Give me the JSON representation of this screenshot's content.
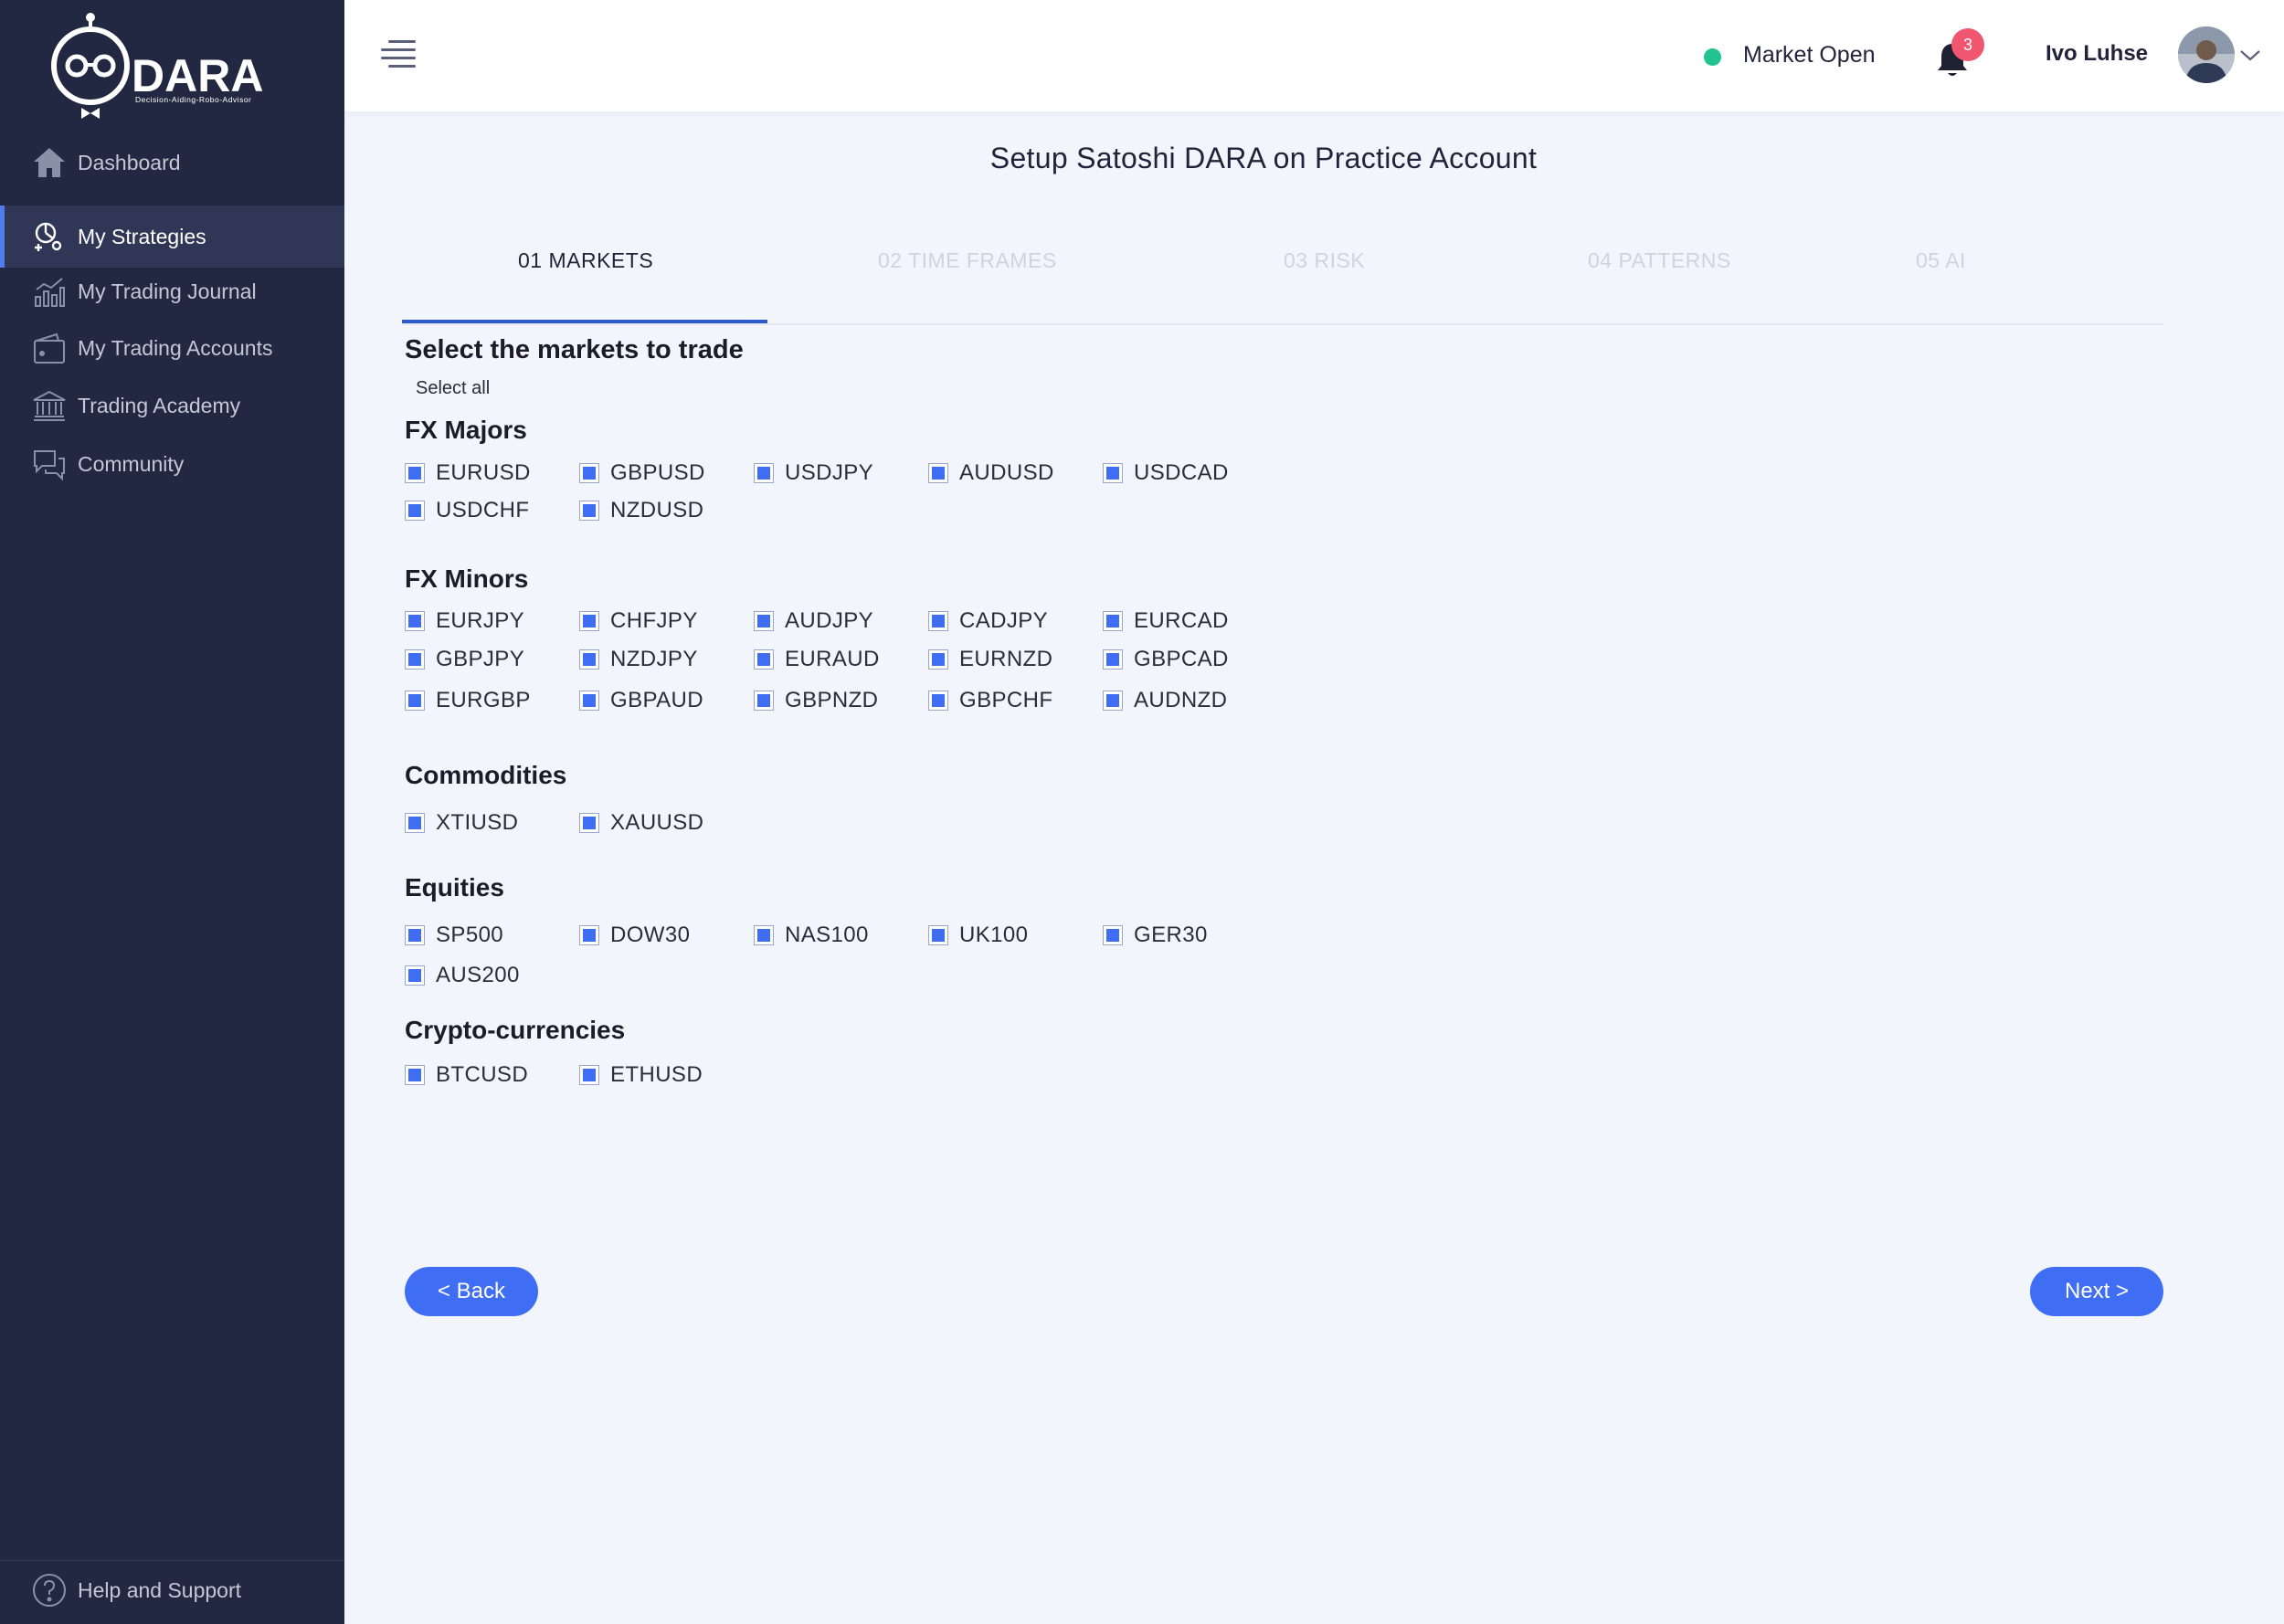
{
  "app": {
    "logo_text": "DARA",
    "logo_tagline": "Decision-Aiding-Robo-Advisor"
  },
  "sidebar": {
    "items": [
      {
        "label": "Dashboard",
        "icon": "home-icon"
      },
      {
        "label": "My Strategies",
        "icon": "strategy-icon",
        "active": true
      },
      {
        "label": "My Trading Journal",
        "icon": "chart-icon"
      },
      {
        "label": "My Trading Accounts",
        "icon": "wallet-icon"
      },
      {
        "label": "Trading Academy",
        "icon": "bank-icon"
      },
      {
        "label": "Community",
        "icon": "chat-icon"
      }
    ],
    "help_label": "Help and Support"
  },
  "header": {
    "market_status": "Market Open",
    "market_status_color": "#22c38e",
    "notification_count": "3",
    "badge_color": "#f0566f",
    "user_name": "Ivo Luhse"
  },
  "main": {
    "title": "Setup Satoshi DARA on Practice Account",
    "tabs": [
      {
        "label": "01  MARKETS",
        "active": true
      },
      {
        "label": "02 TIME  FRAMES"
      },
      {
        "label": "03 RISK"
      },
      {
        "label": "04 PATTERNS"
      },
      {
        "label": "05 AI"
      }
    ],
    "section_heading": "Select the markets to trade",
    "select_all": "Select all",
    "groups": [
      {
        "title": "FX Majors",
        "markets": [
          "EURUSD",
          "GBPUSD",
          "USDJPY",
          "AUDUSD",
          "USDCAD",
          "USDCHF",
          "NZDUSD"
        ]
      },
      {
        "title": "FX Minors",
        "markets": [
          "EURJPY",
          "CHFJPY",
          "AUDJPY",
          "CADJPY",
          "EURCAD",
          "GBPJPY",
          "NZDJPY",
          "EURAUD",
          "EURNZD",
          "GBPCAD",
          "EURGBP",
          "GBPAUD",
          "GBPNZD",
          "GBPCHF",
          "AUDNZD"
        ]
      },
      {
        "title": "Commodities",
        "markets": [
          "XTIUSD",
          "XAUUSD"
        ]
      },
      {
        "title": "Equities",
        "markets": [
          "SP500",
          "DOW30",
          "NAS100",
          "UK100",
          "GER30",
          "AUS200"
        ]
      },
      {
        "title": "Crypto-currencies",
        "markets": [
          "BTCUSD",
          "ETHUSD"
        ]
      }
    ],
    "back_label": "< Back",
    "next_label": "Next >",
    "accent_color": "#3f6ef5"
  }
}
